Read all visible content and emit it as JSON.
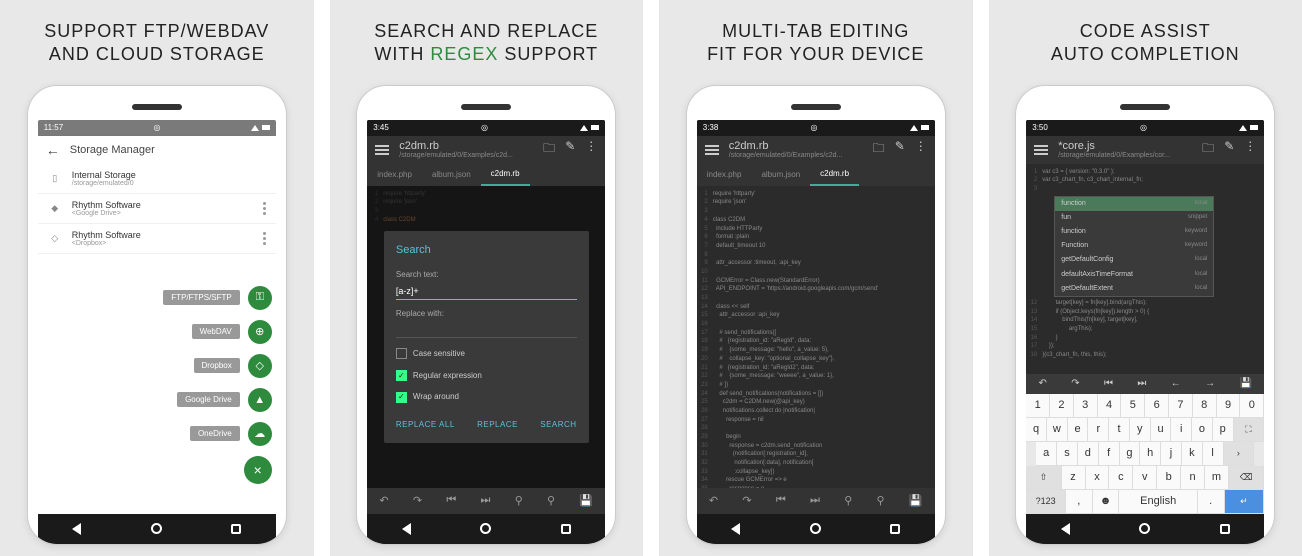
{
  "panels": [
    {
      "caption_line1": "SUPPORT FTP/WEBDAV",
      "caption_line2": "AND CLOUD STORAGE"
    },
    {
      "caption_line1": "SEARCH AND REPLACE",
      "caption_line2_pre": "WITH ",
      "caption_line2_accent": "REGEX",
      "caption_line2_post": " SUPPORT"
    },
    {
      "caption_line1": "MULTI-TAB EDITING",
      "caption_line2": "FIT FOR YOUR DEVICE"
    },
    {
      "caption_line1": "CODE ASSIST",
      "caption_line2": "AUTO COMPLETION"
    }
  ],
  "phone1": {
    "time": "11:57",
    "title": "Storage Manager",
    "items": [
      {
        "name": "Internal Storage",
        "sub": "/storage/emulated/0"
      },
      {
        "name": "Rhythm Software",
        "sub": "<Google Drive>"
      },
      {
        "name": "Rhythm Software",
        "sub": "<Dropbox>"
      }
    ],
    "fabs": [
      "FTP/FTPS/SFTP",
      "WebDAV",
      "Dropbox",
      "Google Drive",
      "OneDrive"
    ]
  },
  "phone2": {
    "time": "3:45",
    "file": "c2dm.rb",
    "path": "/storage/emulated/0/Examples/c2d...",
    "tabs": [
      "index.php",
      "album.json",
      "c2dm.rb"
    ],
    "dialog": {
      "title": "Search",
      "label_search": "Search text:",
      "value_search": "[a-z]+",
      "label_replace": "Replace with:",
      "opt_case": "Case sensitive",
      "opt_regex": "Regular expression",
      "opt_wrap": "Wrap around",
      "btn_replace_all": "REPLACE ALL",
      "btn_replace": "REPLACE",
      "btn_search": "SEARCH"
    }
  },
  "phone3": {
    "time": "3:38",
    "file": "c2dm.rb",
    "path": "/storage/emulated/0/Examples/c2d...",
    "tabs": [
      "index.php",
      "album.json",
      "c2dm.rb"
    ],
    "code": [
      "require 'httparty'",
      "require 'json'",
      "",
      "class C2DM",
      "  include HTTParty",
      "  format :plain",
      "  default_timeout 10",
      "",
      "  attr_accessor :timeout, :api_key",
      "",
      "  GCMError = Class.new(StandardError)",
      "  API_ENDPOINT = 'https://android.googleapis.com/gcm/send'",
      "",
      "  class << self",
      "    attr_accessor :api_key",
      "",
      "    # send_notifications([",
      "    #   {registration_id: \"aRegId\", data:",
      "    #    {some_message: \"hello\", a_value: 5},",
      "    #    collapse_key: \"optional_collapse_key\"},",
      "    #   {registration_id: \"aRegId2\", data:",
      "    #    {some_message: \"weeee\", a_value: 1},",
      "    # ])",
      "    def send_notifications(notifications = [])",
      "      c2dm = C2DM.new(@api_key)",
      "      notifications.collect do |notification|",
      "        response = nil",
      "",
      "        begin",
      "          response = c2dm.send_notification",
      "            (notification[:registration_id],",
      "             notification[:data], notification[",
      "             :collapse_key])",
      "        rescue GCMError => e",
      "          response = e"
    ]
  },
  "phone4": {
    "time": "3:50",
    "file": "*core.js",
    "path": "/storage/emulated/0/Examples/cor...",
    "pre_code": [
      "var c3 = { version: \"0.3.0\" };",
      "var c3_chart_fn, c3_chart_internal_fn;",
      ""
    ],
    "autocomplete": [
      {
        "label": "function",
        "kind": "local",
        "sel": true
      },
      {
        "label": "fun",
        "kind": "snippet"
      },
      {
        "label": "function",
        "kind": "keyword"
      },
      {
        "label": "Function",
        "kind": "keyword"
      },
      {
        "label": "getDefaultConfig",
        "kind": "local"
      },
      {
        "label": "defaultAxisTimeFormat",
        "kind": "local"
      },
      {
        "label": "getDefaultExtent",
        "kind": "local"
      }
    ],
    "post_code": [
      "        target[key] = fn[key].bind(argThis);",
      "        if (Object.keys(fn[key]).length > 0) {",
      "            bindThis(fn[key], target[key],",
      "                argThis);",
      "        }",
      "    });",
      "}(c3_chart_fn, this, this);"
    ],
    "keyboard": {
      "nums": [
        "1",
        "2",
        "3",
        "4",
        "5",
        "6",
        "7",
        "8",
        "9",
        "0"
      ],
      "row1": [
        "q",
        "w",
        "e",
        "r",
        "t",
        "y",
        "u",
        "i",
        "o",
        "p"
      ],
      "row2": [
        "a",
        "s",
        "d",
        "f",
        "g",
        "h",
        "j",
        "k",
        "l"
      ],
      "row3": [
        "z",
        "x",
        "c",
        "v",
        "b",
        "n",
        "m"
      ],
      "sym": "?123",
      "lang": "English"
    }
  }
}
